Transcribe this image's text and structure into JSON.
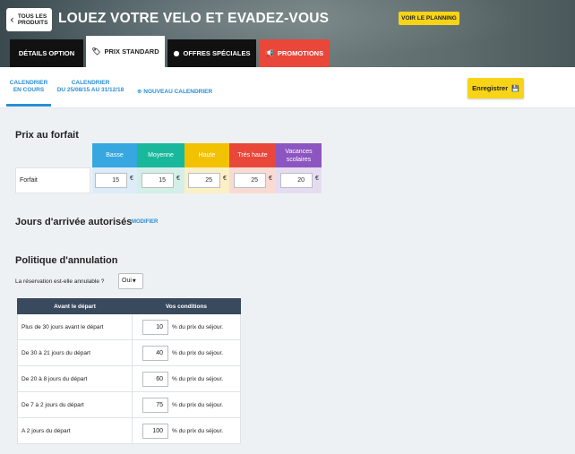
{
  "header": {
    "back_label_line1": "TOUS LES",
    "back_label_line2": "PRODUITS",
    "title": "LOUEZ VOTRE VELO ET EVADEZ-VOUS",
    "planning_button": "VOIR LE PLANNING"
  },
  "tabs": [
    {
      "label": "DÉTAILS OPTION",
      "icon": ""
    },
    {
      "label": "PRIX STANDARD",
      "icon": "tag-icon"
    },
    {
      "label": "OFFRES SPÉCIALES",
      "icon": "circle-icon"
    },
    {
      "label": "PROMOTIONS",
      "icon": "megaphone-icon"
    }
  ],
  "subnav": {
    "current_line1": "CALENDRIER",
    "current_line2": "EN COURS",
    "range_line1": "CALENDRIER",
    "range_line2": "DU 25/08/15 AU 31/12/18",
    "new_calendar": "NOUVEAU CALENDRIER",
    "save_button": "Enregistrer"
  },
  "prix": {
    "title": "Prix au forfait",
    "row_label": "Forfait",
    "currency": "€",
    "columns": [
      {
        "label": "Basse",
        "color": "#37a7e0",
        "cell_color": "#dcecf8",
        "value": "15"
      },
      {
        "label": "Moyenne",
        "color": "#19b89c",
        "cell_color": "#d4efe7",
        "value": "15"
      },
      {
        "label": "Haute",
        "color": "#f2c100",
        "cell_color": "#fbefc6",
        "value": "25"
      },
      {
        "label": "Très haute",
        "color": "#e8473a",
        "cell_color": "#f9dbd3",
        "value": "25"
      },
      {
        "label": "Vacances scolaires",
        "color": "#8d55c0",
        "cell_color": "#e6dcf1",
        "value": "20"
      }
    ]
  },
  "jours": {
    "title": "Jours d'arrivée autorisés",
    "modifier": "MODIFIER"
  },
  "politique": {
    "title": "Politique d'annulation",
    "question": "La réservation est-elle annulable ?",
    "select_value": "Oui",
    "col_depart": "Avant le départ",
    "col_conditions": "Vos conditions",
    "suffix": "% du prix du séjour.",
    "rows": [
      {
        "label": "Plus de 30 jours avant le départ",
        "value": "10"
      },
      {
        "label": "De 30 à 21 jours du départ",
        "value": "40"
      },
      {
        "label": "De 20 à 8 jours du départ",
        "value": "60"
      },
      {
        "label": "De 7 à 2 jours du départ",
        "value": "75"
      },
      {
        "label": "A 2 jours du départ",
        "value": "100"
      }
    ]
  }
}
